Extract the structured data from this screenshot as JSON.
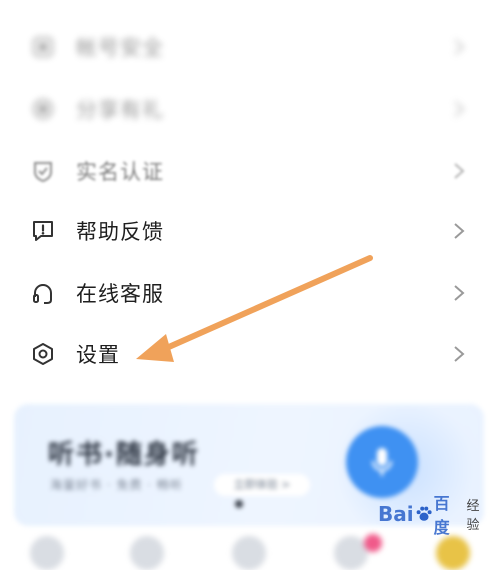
{
  "menu": {
    "items": [
      {
        "label": "帐号安全",
        "icon": "shield-icon",
        "visibility": "blurred"
      },
      {
        "label": "分享有礼",
        "icon": "gift-icon",
        "visibility": "blurred"
      },
      {
        "label": "实名认证",
        "icon": "verified-shield-icon",
        "visibility": "faded"
      },
      {
        "label": "帮助反馈",
        "icon": "feedback-icon",
        "visibility": "clear"
      },
      {
        "label": "在线客服",
        "icon": "headset-icon",
        "visibility": "clear"
      },
      {
        "label": "设置",
        "icon": "settings-gear-icon",
        "visibility": "clear"
      }
    ]
  },
  "promo_card": {
    "title": "听书·随身听",
    "subtitle": "海量好书 · 免费 · 畅听",
    "chip": "立即体验 >",
    "mic_icon": "microphone-icon",
    "accent_color": "#3f91f2"
  },
  "annotation": {
    "arrow_color": "#f0a25a",
    "points_to": "设置"
  },
  "watermark": {
    "brand": "Bai",
    "brand_suffix": "百度",
    "sub": "经验"
  },
  "colors": {
    "text": "#1f1f1f",
    "icon": "#333333",
    "chevron": "#9a9a9a"
  }
}
